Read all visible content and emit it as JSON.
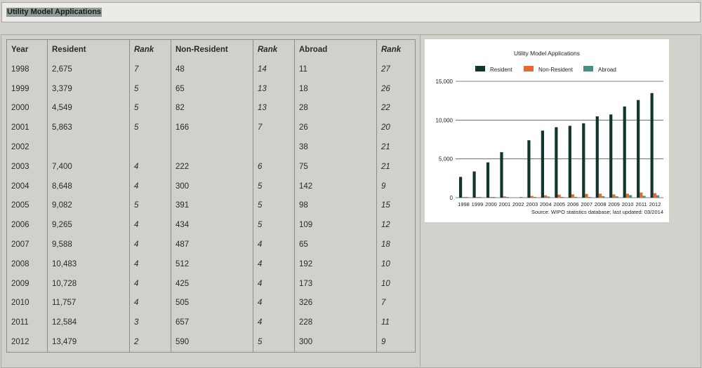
{
  "header": {
    "title": "Utility Model Applications"
  },
  "table": {
    "columns": [
      "Year",
      "Resident",
      "Rank",
      "Non-Resident",
      "Rank",
      "Abroad",
      "Rank"
    ],
    "rows": [
      [
        "1998",
        "2,675",
        "7",
        "48",
        "14",
        "11",
        "27"
      ],
      [
        "1999",
        "3,379",
        "5",
        "65",
        "13",
        "18",
        "26"
      ],
      [
        "2000",
        "4,549",
        "5",
        "82",
        "13",
        "28",
        "22"
      ],
      [
        "2001",
        "5,863",
        "5",
        "166",
        "7",
        "26",
        "20"
      ],
      [
        "2002",
        "",
        "",
        "",
        "",
        "38",
        "21"
      ],
      [
        "2003",
        "7,400",
        "4",
        "222",
        "6",
        "75",
        "21"
      ],
      [
        "2004",
        "8,648",
        "4",
        "300",
        "5",
        "142",
        "9"
      ],
      [
        "2005",
        "9,082",
        "5",
        "391",
        "5",
        "98",
        "15"
      ],
      [
        "2006",
        "9,265",
        "4",
        "434",
        "5",
        "109",
        "12"
      ],
      [
        "2007",
        "9,588",
        "4",
        "487",
        "4",
        "65",
        "18"
      ],
      [
        "2008",
        "10,483",
        "4",
        "512",
        "4",
        "192",
        "10"
      ],
      [
        "2009",
        "10,728",
        "4",
        "425",
        "4",
        "173",
        "10"
      ],
      [
        "2010",
        "11,757",
        "4",
        "505",
        "4",
        "326",
        "7"
      ],
      [
        "2011",
        "12,584",
        "3",
        "657",
        "4",
        "228",
        "11"
      ],
      [
        "2012",
        "13,479",
        "2",
        "590",
        "5",
        "300",
        "9"
      ]
    ]
  },
  "chart_data": {
    "type": "bar",
    "title": "Utility Model Applications",
    "source": "Source: WIPO statistics database; last updated: 03/2014",
    "categories": [
      "1998",
      "1999",
      "2000",
      "2001",
      "2002",
      "2003",
      "2004",
      "2005",
      "2006",
      "2007",
      "2008",
      "2009",
      "2010",
      "2011",
      "2012"
    ],
    "series": [
      {
        "name": "Resident",
        "color": "#12362d",
        "values": [
          2675,
          3379,
          4549,
          5863,
          null,
          7400,
          8648,
          9082,
          9265,
          9588,
          10483,
          10728,
          11757,
          12584,
          13479
        ]
      },
      {
        "name": "Non-Resident",
        "color": "#e8692a",
        "values": [
          48,
          65,
          82,
          166,
          null,
          222,
          300,
          391,
          434,
          487,
          512,
          425,
          505,
          657,
          590
        ]
      },
      {
        "name": "Abroad",
        "color": "#4c8f87",
        "values": [
          11,
          18,
          28,
          26,
          38,
          75,
          142,
          98,
          109,
          65,
          192,
          173,
          326,
          228,
          300
        ]
      }
    ],
    "yticks": [
      "0",
      "5,000",
      "10,000",
      "15,000"
    ],
    "ytick_values": [
      0,
      5000,
      10000,
      15000
    ],
    "ylim": [
      0,
      15000
    ],
    "legend_position": "top",
    "grid": true
  }
}
